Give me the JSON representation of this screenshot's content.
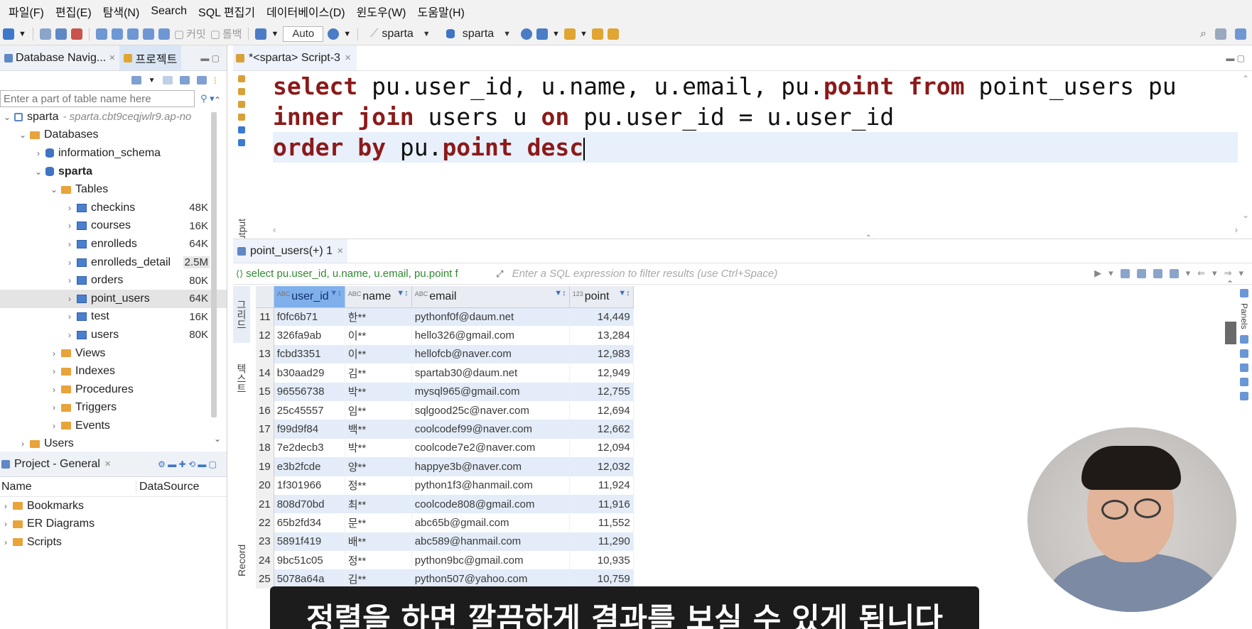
{
  "menu": [
    "파일(F)",
    "편집(E)",
    "탐색(N)",
    "Search",
    "SQL 편집기",
    "데이터베이스(D)",
    "윈도우(W)",
    "도움말(H)"
  ],
  "toolbar": {
    "commit_label": "커밋",
    "rollback_label": "롤백",
    "auto_label": "Auto",
    "datasource": "sparta",
    "schema": "sparta"
  },
  "navigator": {
    "tab_db": "Database Navig...",
    "tab_project": "프로젝트",
    "filter_placeholder": "Enter a part of table name here",
    "tree": [
      {
        "label": "sparta",
        "sub": "- sparta.cbt9ceqjwlr9.ap-no",
        "level": 0,
        "kind": "conn",
        "toggle": "⌄"
      },
      {
        "label": "Databases",
        "level": 1,
        "kind": "folder",
        "toggle": "⌄"
      },
      {
        "label": "information_schema",
        "level": 2,
        "kind": "db",
        "toggle": "›"
      },
      {
        "label": "sparta",
        "level": 2,
        "kind": "db",
        "toggle": "⌄",
        "bold": true
      },
      {
        "label": "Tables",
        "level": 3,
        "kind": "folder",
        "toggle": "⌄"
      },
      {
        "label": "checkins",
        "level": 4,
        "kind": "table",
        "toggle": "›",
        "size": "48K"
      },
      {
        "label": "courses",
        "level": 4,
        "kind": "table",
        "toggle": "›",
        "size": "16K"
      },
      {
        "label": "enrolleds",
        "level": 4,
        "kind": "table",
        "toggle": "›",
        "size": "64K"
      },
      {
        "label": "enrolleds_detail",
        "level": 4,
        "kind": "table",
        "toggle": "›",
        "size": "2.5M"
      },
      {
        "label": "orders",
        "level": 4,
        "kind": "table",
        "toggle": "›",
        "size": "80K"
      },
      {
        "label": "point_users",
        "level": 4,
        "kind": "table",
        "toggle": "›",
        "size": "64K",
        "selected": true
      },
      {
        "label": "test",
        "level": 4,
        "kind": "table",
        "toggle": "›",
        "size": "16K"
      },
      {
        "label": "users",
        "level": 4,
        "kind": "table",
        "toggle": "›",
        "size": "80K"
      },
      {
        "label": "Views",
        "level": 3,
        "kind": "folder",
        "toggle": "›"
      },
      {
        "label": "Indexes",
        "level": 3,
        "kind": "folder",
        "toggle": "›"
      },
      {
        "label": "Procedures",
        "level": 3,
        "kind": "folder",
        "toggle": "›"
      },
      {
        "label": "Triggers",
        "level": 3,
        "kind": "folder",
        "toggle": "›"
      },
      {
        "label": "Events",
        "level": 3,
        "kind": "folder",
        "toggle": "›"
      },
      {
        "label": "Users",
        "level": 1,
        "kind": "folder",
        "toggle": "›"
      }
    ]
  },
  "project": {
    "title": "Project - General",
    "col_name": "Name",
    "col_datasource": "DataSource",
    "items": [
      "Bookmarks",
      "ER Diagrams",
      "Scripts"
    ]
  },
  "editor": {
    "tab_label": "*<sparta> Script-3",
    "output_label": "Output",
    "lines": [
      [
        {
          "t": "select ",
          "k": true
        },
        {
          "t": "pu.user_id, u.name, u.email, pu.",
          "k": false
        },
        {
          "t": "point",
          "k": true
        },
        {
          "t": " ",
          "k": false
        },
        {
          "t": "from",
          "k": true
        },
        {
          "t": " point_users pu",
          "k": false
        }
      ],
      [
        {
          "t": "inner join",
          "k": true
        },
        {
          "t": " users u ",
          "k": false
        },
        {
          "t": "on",
          "k": true
        },
        {
          "t": " pu.user_id = u.user_id",
          "k": false
        }
      ],
      [
        {
          "t": "order by",
          "k": true
        },
        {
          "t": " pu.",
          "k": false
        },
        {
          "t": "point",
          "k": true
        },
        {
          "t": " ",
          "k": false
        },
        {
          "t": "desc",
          "k": true
        }
      ]
    ]
  },
  "results": {
    "tab_label": "point_users(+) 1",
    "query_text": "select pu.user_id, u.name, u.email, pu.point f",
    "filter_placeholder": "Enter a SQL expression to filter results (use Ctrl+Space)",
    "side_grid": "그리드",
    "side_text": "텍스트",
    "side_record": "Record",
    "panels_label": "Panels",
    "columns": [
      "user_id",
      "name",
      "email",
      "point"
    ],
    "rows": [
      [
        "11",
        "f0fc6b71",
        "한**",
        "pythonf0f@daum.net",
        "14,449"
      ],
      [
        "12",
        "326fa9ab",
        "이**",
        "hello326@gmail.com",
        "13,284"
      ],
      [
        "13",
        "fcbd3351",
        "이**",
        "hellofcb@naver.com",
        "12,983"
      ],
      [
        "14",
        "b30aad29",
        "김**",
        "spartab30@daum.net",
        "12,949"
      ],
      [
        "15",
        "96556738",
        "박**",
        "mysql965@gmail.com",
        "12,755"
      ],
      [
        "16",
        "25c45557",
        "임**",
        "sqlgood25c@naver.com",
        "12,694"
      ],
      [
        "17",
        "f99d9f84",
        "백**",
        "coolcodef99@naver.com",
        "12,662"
      ],
      [
        "18",
        "7e2decb3",
        "박**",
        "coolcode7e2@naver.com",
        "12,094"
      ],
      [
        "19",
        "e3b2fcde",
        "양**",
        "happye3b@naver.com",
        "12,032"
      ],
      [
        "20",
        "1f301966",
        "정**",
        "python1f3@hanmail.com",
        "11,924"
      ],
      [
        "21",
        "808d70bd",
        "최**",
        "coolcode808@gmail.com",
        "11,916"
      ],
      [
        "22",
        "65b2fd34",
        "문**",
        "abc65b@gmail.com",
        "11,552"
      ],
      [
        "23",
        "5891f419",
        "배**",
        "abc589@hanmail.com",
        "11,290"
      ],
      [
        "24",
        "9bc51c05",
        "정**",
        "python9bc@gmail.com",
        "10,935"
      ],
      [
        "25",
        "5078a64a",
        "김**",
        "python507@yahoo.com",
        "10,759"
      ]
    ]
  },
  "subtitle": "정렬을 하면 깔끔하게 결과를 보실 수 있게 됩니다"
}
